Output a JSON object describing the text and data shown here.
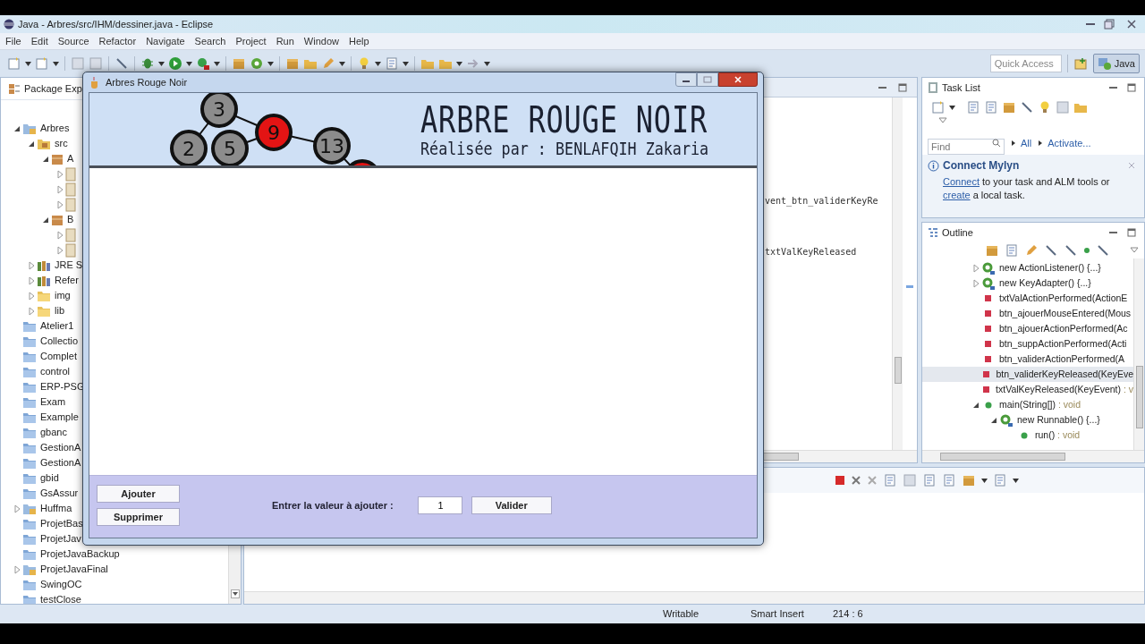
{
  "window": {
    "title": "Java - Arbres/src/IHM/dessiner.java - Eclipse"
  },
  "menu": [
    "File",
    "Edit",
    "Source",
    "Refactor",
    "Navigate",
    "Search",
    "Project",
    "Run",
    "Window",
    "Help"
  ],
  "quick_access": {
    "placeholder": "Quick Access"
  },
  "perspective": {
    "label": "Java"
  },
  "package_explorer": {
    "title": "Package Exp",
    "tree": [
      {
        "kind": "java-project",
        "label": "Arbres",
        "expanded": true,
        "children": [
          {
            "kind": "source",
            "label": "src",
            "expanded": true,
            "children": [
              {
                "kind": "package",
                "label": "A",
                "expanded": true,
                "children": [
                  {
                    "kind": "file",
                    "expanded": false
                  },
                  {
                    "kind": "file",
                    "expanded": false
                  },
                  {
                    "kind": "file",
                    "expanded": false
                  }
                ]
              },
              {
                "kind": "package",
                "label": "B",
                "expanded": true,
                "children": [
                  {
                    "kind": "file",
                    "expanded": false
                  },
                  {
                    "kind": "file",
                    "expanded": false
                  }
                ]
              }
            ]
          },
          {
            "kind": "library",
            "label": "JRE S",
            "expanded": false
          },
          {
            "kind": "library",
            "label": "Refer",
            "expanded": false
          },
          {
            "kind": "folder",
            "label": "img",
            "expanded": false
          },
          {
            "kind": "folder",
            "label": "lib",
            "expanded": false
          }
        ]
      },
      {
        "kind": "project",
        "label": "Atelier1"
      },
      {
        "kind": "project",
        "label": "Collectio"
      },
      {
        "kind": "project",
        "label": "Complet"
      },
      {
        "kind": "project",
        "label": "control"
      },
      {
        "kind": "project",
        "label": "ERP-PSG"
      },
      {
        "kind": "project",
        "label": "Exam"
      },
      {
        "kind": "project",
        "label": "Example"
      },
      {
        "kind": "project",
        "label": "gbanc"
      },
      {
        "kind": "project",
        "label": "GestionA"
      },
      {
        "kind": "project",
        "label": "GestionA"
      },
      {
        "kind": "project",
        "label": "gbid"
      },
      {
        "kind": "project",
        "label": "GsAssur"
      },
      {
        "kind": "java-project",
        "label": "Huffma",
        "expanded": false
      },
      {
        "kind": "project",
        "label": "ProjetBas"
      },
      {
        "kind": "project",
        "label": "ProjetJav"
      },
      {
        "kind": "project",
        "label": "ProjetJavaBackup"
      },
      {
        "kind": "java-project",
        "label": "ProjetJavaFinal",
        "expanded": false
      },
      {
        "kind": "project",
        "label": "SwingOC"
      },
      {
        "kind": "project",
        "label": "testClose"
      }
    ]
  },
  "editor": {
    "code_lines": [
      "vent_btn_validerKeyRe",
      "txtValKeyReleased"
    ]
  },
  "task_list": {
    "title": "Task List",
    "find": {
      "placeholder": "Find"
    },
    "filters": [
      "All",
      "Activate..."
    ],
    "mylyn": {
      "title": "Connect Mylyn",
      "message": [
        {
          "text": "Connect",
          "link": true
        },
        {
          "text": " to your task and ALM tools or ",
          "link": false
        },
        {
          "text": "create",
          "link": true
        },
        {
          "text": " a local task.",
          "link": false
        }
      ]
    }
  },
  "outline": {
    "title": "Outline",
    "items": [
      {
        "kind": "anonymous-class",
        "label": "new ActionListener() {...}",
        "expanded": false,
        "selected": false
      },
      {
        "kind": "anonymous-class",
        "label": "new KeyAdapter() {...}",
        "expanded": false,
        "selected": false
      },
      {
        "kind": "private-method",
        "label": "txtValActionPerformed(ActionE",
        "selected": false
      },
      {
        "kind": "private-method",
        "label": "btn_ajouerMouseEntered(Mous",
        "selected": false
      },
      {
        "kind": "private-method",
        "label": "btn_ajouerActionPerformed(Ac",
        "selected": false
      },
      {
        "kind": "private-method",
        "label": "btn_suppActionPerformed(Acti",
        "selected": false
      },
      {
        "kind": "private-method",
        "label": "btn_validerActionPerformed(A",
        "selected": false
      },
      {
        "kind": "private-method",
        "label": "btn_validerKeyReleased(KeyEve",
        "selected": true
      },
      {
        "kind": "private-method",
        "label": "txtValKeyReleased(KeyEvent)",
        "type": " : v",
        "selected": false
      },
      {
        "kind": "public-method",
        "label": "main(String[])",
        "type": " : void",
        "expanded": true,
        "selected": false,
        "children": [
          {
            "kind": "anonymous-class",
            "label": "new Runnable() {...}",
            "expanded": true,
            "selected": false,
            "children": [
              {
                "kind": "public-method",
                "label": "run()",
                "type": " : void",
                "selected": false
              }
            ]
          }
        ]
      }
    ]
  },
  "status_bar": [
    "Writable",
    "Smart Insert",
    "214 : 6"
  ],
  "dialog": {
    "title": "Arbres Rouge Noir",
    "banner": {
      "title": "ARBRE ROUGE NOIR",
      "subtitle": "Réalisée par : BENLAFQIH Zakaria",
      "nodes": [
        {
          "label": "3",
          "color": "#8c8c8c"
        },
        {
          "label": "9",
          "color": "#e31414"
        },
        {
          "label": "2",
          "color": "#8c8c8c"
        },
        {
          "label": "5",
          "color": "#8c8c8c"
        },
        {
          "label": "13",
          "color": "#8c8c8c"
        },
        {
          "color": "#e31414"
        }
      ]
    },
    "buttons": [
      "Ajouter",
      "Supprimer"
    ],
    "value_label": "Entrer la valeur à ajouter :",
    "value_field": {
      "value": "1"
    },
    "submit": "Valider"
  }
}
